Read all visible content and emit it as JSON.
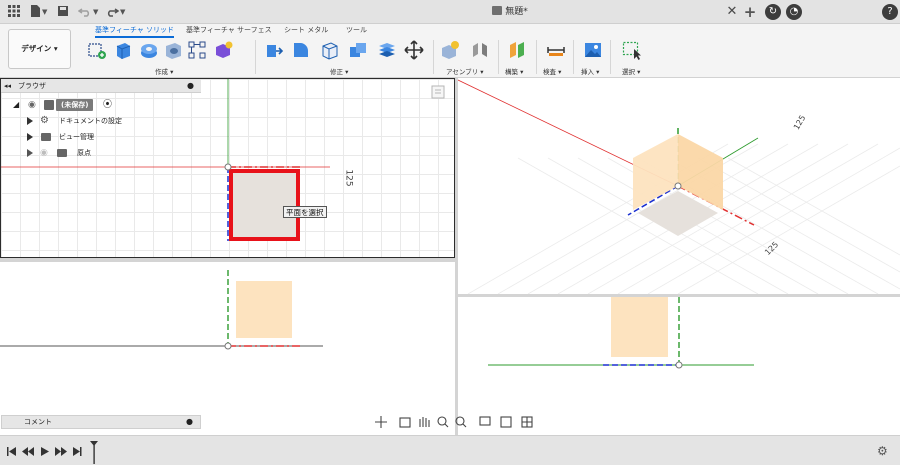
{
  "titlebar": {
    "document_title": "無題*",
    "icons": [
      "app-grid-icon",
      "file-icon",
      "save-icon",
      "undo-icon",
      "redo-icon",
      "close-tab-icon",
      "new-tab-icon",
      "online-status-icon",
      "job-status-icon",
      "help-icon"
    ]
  },
  "ribbon": {
    "workspace_button": "デザイン ▾",
    "tabs": [
      "基準フィーチャ ソリッド",
      "基準フィーチャ サーフェス",
      "シート メタル",
      "ツール"
    ],
    "groups": [
      "作成 ▾",
      "修正 ▾",
      "アセンブリ ▾",
      "構築 ▾",
      "検査 ▾",
      "挿入 ▾",
      "選択 ▾"
    ]
  },
  "browser": {
    "title": "ブラウザ",
    "items": [
      {
        "label": "(未保存)"
      },
      {
        "label": "ドキュメントの設定"
      },
      {
        "label": "ビュー管理"
      },
      {
        "label": "原点"
      }
    ]
  },
  "viewport": {
    "tooltip": "平面を選択",
    "dimension_top": "125",
    "dimension_iso_a": "125",
    "dimension_iso_b": "125"
  },
  "comments": {
    "label": "コメント"
  },
  "colors": {
    "x_axis": "#e03030",
    "y_axis": "#2e9b2e",
    "z_axis": "#1a2fd0",
    "plane_fill": "#fde3bf",
    "selection": "#e8121a",
    "accent": "#0b6bd6"
  }
}
